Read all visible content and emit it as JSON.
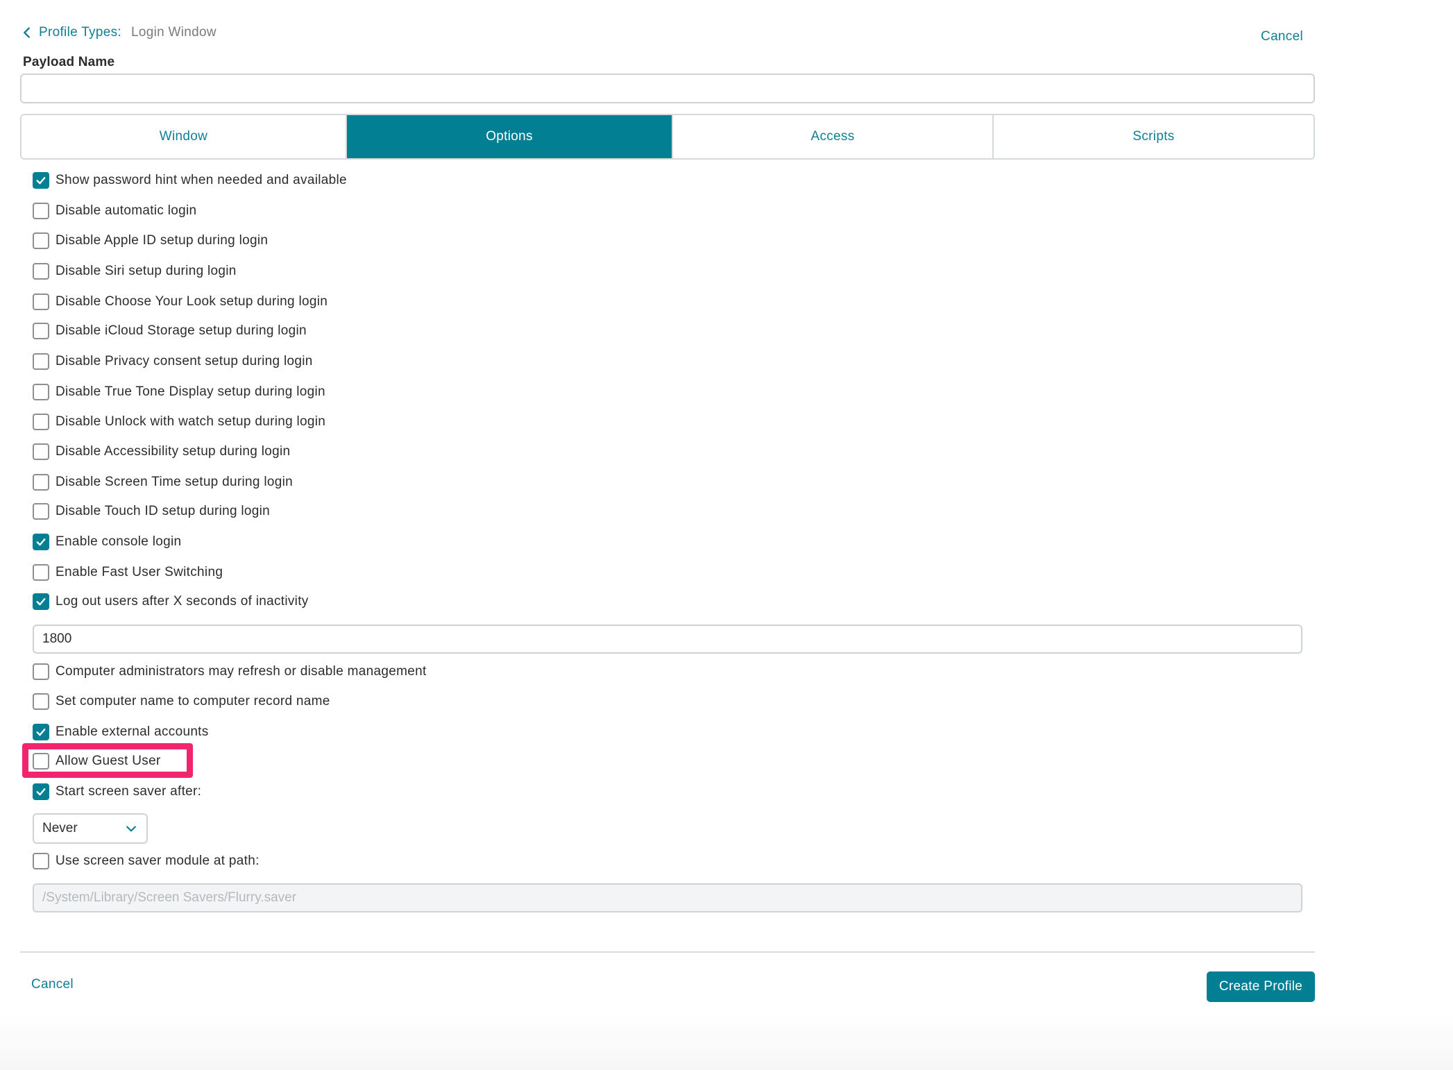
{
  "header": {
    "breadcrumb_link": "Profile Types:",
    "breadcrumb_current": "Login Window",
    "cancel_label": "Cancel"
  },
  "payload": {
    "label": "Payload Name",
    "value": ""
  },
  "tabs": [
    {
      "label": "Window",
      "active": false
    },
    {
      "label": "Options",
      "active": true
    },
    {
      "label": "Access",
      "active": false
    },
    {
      "label": "Scripts",
      "active": false
    }
  ],
  "options": [
    {
      "label": "Show password hint when needed and available",
      "checked": true
    },
    {
      "label": "Disable automatic login",
      "checked": false
    },
    {
      "label": "Disable Apple ID setup during login",
      "checked": false
    },
    {
      "label": "Disable Siri setup during login",
      "checked": false
    },
    {
      "label": "Disable Choose Your Look setup during login",
      "checked": false
    },
    {
      "label": "Disable iCloud Storage setup during login",
      "checked": false
    },
    {
      "label": "Disable Privacy consent setup during login",
      "checked": false
    },
    {
      "label": "Disable True Tone Display setup during login",
      "checked": false
    },
    {
      "label": "Disable Unlock with watch setup during login",
      "checked": false
    },
    {
      "label": "Disable Accessibility setup during login",
      "checked": false
    },
    {
      "label": "Disable Screen Time setup during login",
      "checked": false
    },
    {
      "label": "Disable Touch ID setup during login",
      "checked": false
    },
    {
      "label": "Enable console login",
      "checked": true
    },
    {
      "label": "Enable Fast User Switching",
      "checked": false
    },
    {
      "label": "Log out users after X seconds of inactivity",
      "checked": true
    },
    {
      "label": "Computer administrators may refresh or disable management",
      "checked": false
    },
    {
      "label": "Set computer name to computer record name",
      "checked": false
    },
    {
      "label": "Enable external accounts",
      "checked": true
    },
    {
      "label": "Allow Guest User",
      "checked": false
    },
    {
      "label": "Start screen saver after:",
      "checked": true
    },
    {
      "label": "Use screen saver module at path:",
      "checked": false
    }
  ],
  "logout_seconds": {
    "value": "1800"
  },
  "screensaver_delay": {
    "selected": "Never"
  },
  "screensaver_path": {
    "placeholder": "/System/Library/Screen Savers/Flurry.saver"
  },
  "footer": {
    "cancel_label": "Cancel",
    "create_label": "Create Profile"
  },
  "colors": {
    "accent": "#037f94",
    "highlight": "#f0256e"
  },
  "icons": {
    "back": "chevron-left-icon",
    "check": "checkmark-icon",
    "dropdown": "chevron-down-icon"
  }
}
